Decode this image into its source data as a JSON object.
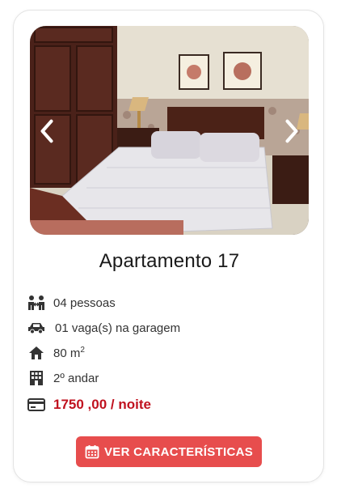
{
  "listing": {
    "title": "Apartamento 17",
    "features": {
      "guests": "04 pessoas",
      "parking": "01 vaga(s) na garagem",
      "area": "80 m",
      "area_exp": "2",
      "floor": "2º andar"
    },
    "price": "1750 ,00 / noite",
    "cta_label": "VER CARACTERÍSTICAS"
  },
  "icons": {
    "prev": "chevron-left-icon",
    "next": "chevron-right-icon",
    "guests": "people-icon",
    "parking": "car-icon",
    "area": "house-icon",
    "floor": "building-icon",
    "price": "credit-card-icon",
    "cta": "calendar-icon"
  },
  "colors": {
    "accent": "#e74d4d",
    "price": "#c0121f"
  }
}
